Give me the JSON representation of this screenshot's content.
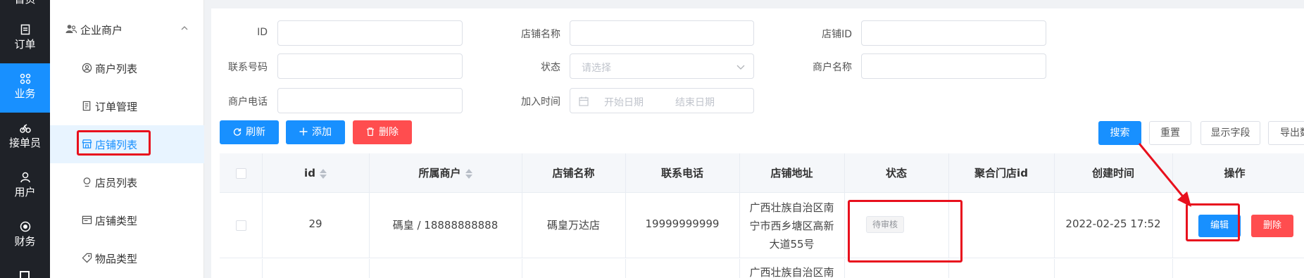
{
  "rail": {
    "top_label": "首页",
    "items": [
      {
        "label": "订单",
        "icon": "order-icon"
      },
      {
        "label": "业务",
        "icon": "grid-icon",
        "active": true
      },
      {
        "label": "接单员",
        "icon": "bike-icon"
      },
      {
        "label": "用户",
        "icon": "user-icon"
      },
      {
        "label": "财务",
        "icon": "finance-icon"
      }
    ]
  },
  "menu": {
    "group_label": "企业商户",
    "items": [
      {
        "label": "商户列表",
        "icon": "merchant-icon"
      },
      {
        "label": "订单管理",
        "icon": "order-doc-icon"
      },
      {
        "label": "店铺列表",
        "icon": "store-icon",
        "active": true
      },
      {
        "label": "店员列表",
        "icon": "clerk-icon"
      },
      {
        "label": "店铺类型",
        "icon": "store-type-icon"
      },
      {
        "label": "物品类型",
        "icon": "tag-icon"
      }
    ]
  },
  "filters": {
    "id_label": "ID",
    "store_name_label": "店铺名称",
    "store_id_label": "店铺ID",
    "contact_label": "联系号码",
    "status_label": "状态",
    "status_placeholder": "请选择",
    "merchant_name_label": "商户名称",
    "merchant_phone_label": "商户电话",
    "join_time_label": "加入时间",
    "start_placeholder": "开始日期",
    "end_placeholder": "结束日期"
  },
  "toolbar": {
    "refresh": "刷新",
    "add": "添加",
    "delete": "删除",
    "search": "搜索",
    "reset": "重置",
    "show_fields": "显示字段",
    "export": "导出数"
  },
  "table": {
    "headers": [
      "id",
      "所属商户",
      "店铺名称",
      "联系电话",
      "店铺地址",
      "状态",
      "聚合门店id",
      "创建时间",
      "操作"
    ],
    "rows": [
      {
        "id": "29",
        "merchant": "碼皇 / 18888888888",
        "store_name": "碼皇万达店",
        "phone": "19999999999",
        "address_lines": [
          "广西壮族自治区南",
          "宁市西乡塘区高新",
          "大道55号"
        ],
        "status": "待审核",
        "aggregate_id": "",
        "created": "2022-02-25 17:52",
        "edit": "编辑",
        "delete": "删除"
      }
    ],
    "row2_address": "广西壮族自治区南"
  },
  "colors": {
    "primary": "#1890ff",
    "danger": "#ff4d4f",
    "highlight": "#e8101d",
    "rail_bg": "#1f2228"
  }
}
